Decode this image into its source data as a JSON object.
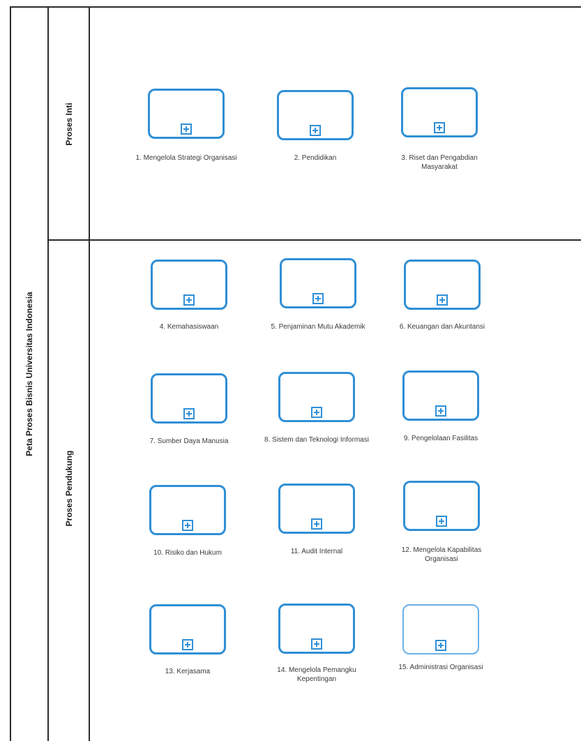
{
  "pool": {
    "title": "Peta Proses Bisnis Universitas Indonesia"
  },
  "lanes": [
    {
      "title": "Proses Inti"
    },
    {
      "title": "Proses Pendukung"
    }
  ],
  "colors": {
    "task_border": "#2f8fd6",
    "line": "#2b2b2b"
  },
  "tasks": [
    {
      "label": "1. Mengelola Strategi Organisasi"
    },
    {
      "label": "2. Pendidikan"
    },
    {
      "label": "3. Riset dan Pengabdian Masyarakat"
    },
    {
      "label": "4. Kemahasiswaan"
    },
    {
      "label": "5. Penjaminan Mutu Akademik"
    },
    {
      "label": "6. Keuangan dan Akuntansi"
    },
    {
      "label": "7. Sumber Daya Manusia"
    },
    {
      "label": "8. Sistem dan Teknologi Informasi"
    },
    {
      "label": "9. Pengelolaan Fasilitas"
    },
    {
      "label": "10. Risiko dan Hukum"
    },
    {
      "label": "11. Audit Internal"
    },
    {
      "label": "12. Mengelola Kapabilitas Organisasi"
    },
    {
      "label": "13. Kerjasama"
    },
    {
      "label": "14. Mengelola Pemangku Kepentingan"
    },
    {
      "label": "15. Administrasi Organisasi"
    }
  ]
}
